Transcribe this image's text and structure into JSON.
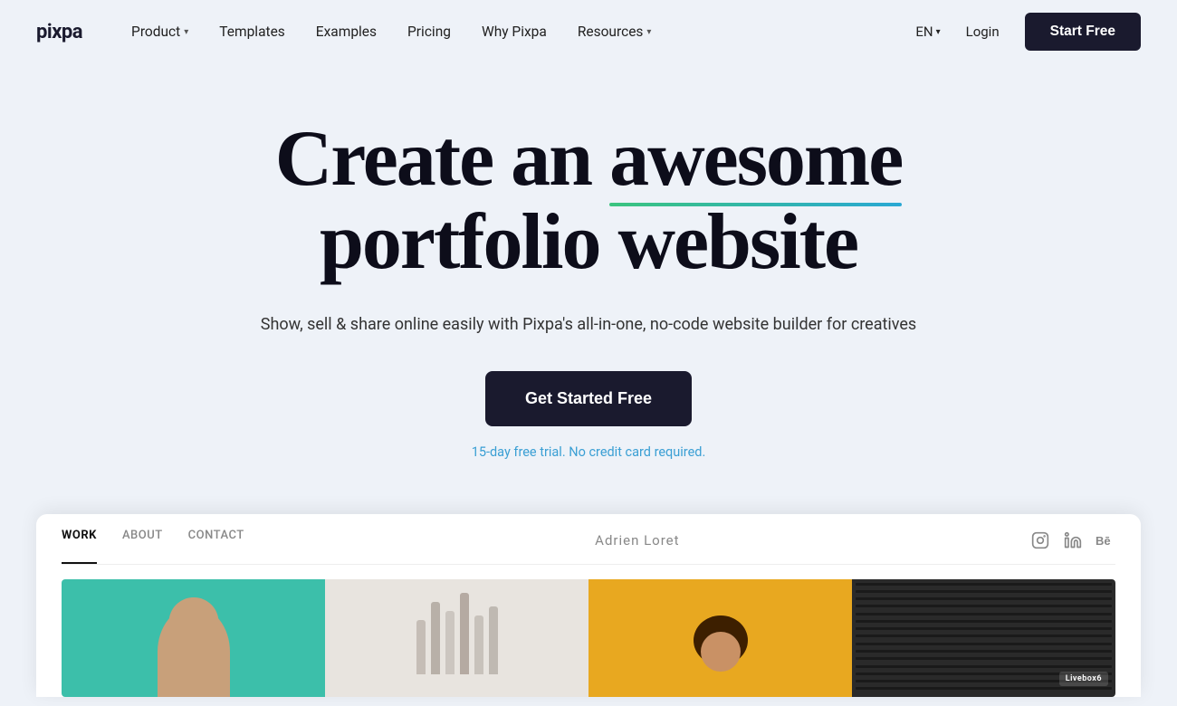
{
  "brand": {
    "logo": "pixpa"
  },
  "nav": {
    "links": [
      {
        "label": "Product",
        "has_dropdown": true
      },
      {
        "label": "Templates",
        "has_dropdown": false
      },
      {
        "label": "Examples",
        "has_dropdown": false
      },
      {
        "label": "Pricing",
        "has_dropdown": false
      },
      {
        "label": "Why Pixpa",
        "has_dropdown": false
      },
      {
        "label": "Resources",
        "has_dropdown": true
      }
    ],
    "lang": "EN",
    "login": "Login",
    "start_free": "Start Free"
  },
  "hero": {
    "title_line1": "Create an awesome",
    "title_underline_word": "awesome",
    "title_line2": "portfolio website",
    "subtitle": "Show, sell & share online easily with Pixpa's all-in-one, no-code website builder for creatives",
    "cta_button": "Get Started Free",
    "trial_text": "15-day free trial. No credit card required."
  },
  "portfolio_preview": {
    "nav_work": "WORK",
    "nav_about": "ABOUT",
    "nav_contact": "CONTACT",
    "person_name": "Adrien Loret",
    "livebox_label": "Livebox6"
  }
}
